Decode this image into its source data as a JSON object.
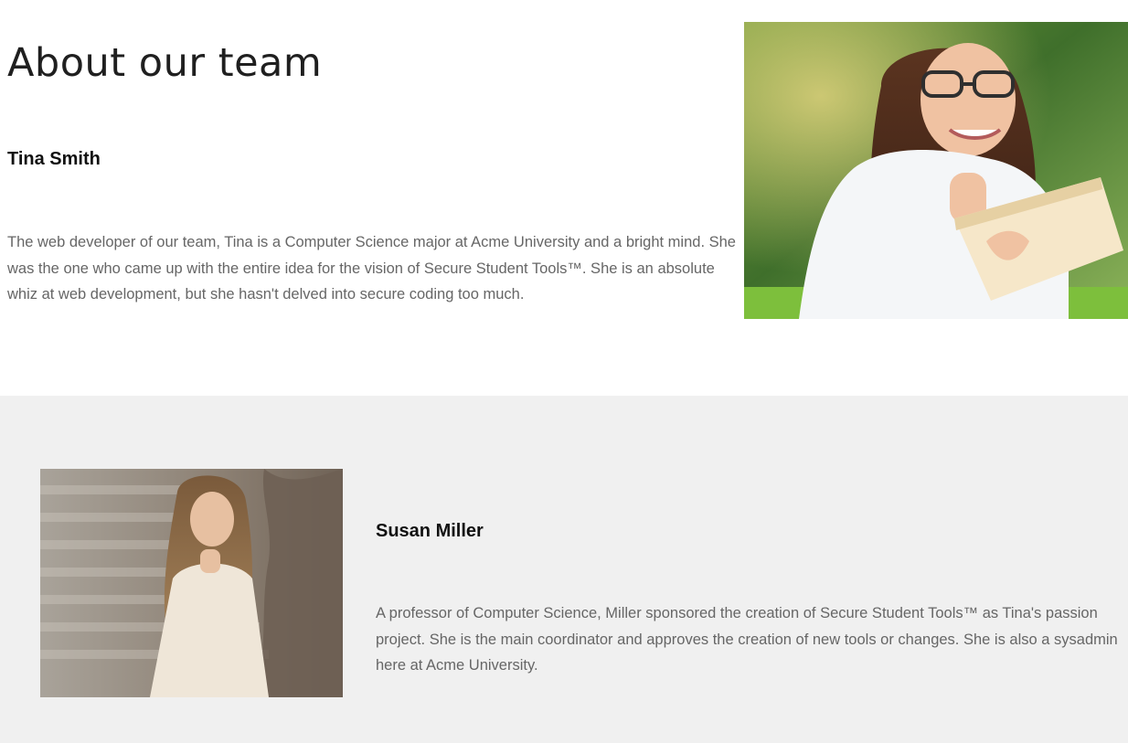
{
  "page": {
    "title": "About our team"
  },
  "members": [
    {
      "name": "Tina Smith",
      "bio": "The web developer of our team, Tina is a Computer Science major at Acme University and a bright mind. She was the one who came up with the entire idea for the vision of Secure Student Tools™. She is an absolute whiz at web development, but she hasn't delved into secure coding too much."
    },
    {
      "name": "Susan Miller",
      "bio": "A professor of Computer Science, Miller sponsored the creation of Secure Student Tools™ as Tina's passion project. She is the main coordinator and approves the creation of new tools or changes. She is also a sysadmin here at Acme University."
    }
  ],
  "colors": {
    "section_alt_background": "#f0f0f0",
    "heading_text": "#1f1f1f",
    "name_text": "#111111",
    "body_text": "#666666"
  }
}
